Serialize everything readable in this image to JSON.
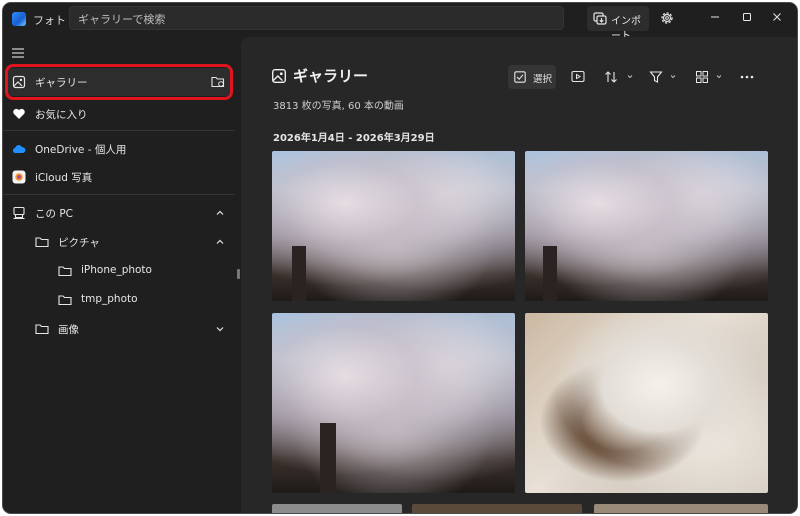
{
  "app": {
    "title": "フォト"
  },
  "search": {
    "placeholder": "ギャラリーで検索"
  },
  "titlebar": {
    "import_label": "インポート"
  },
  "sidebar": {
    "items": [
      {
        "label": "ギャラリー",
        "icon": "gallery-icon",
        "selected": true
      },
      {
        "label": "お気に入り",
        "icon": "heart-icon"
      },
      {
        "label": "OneDrive - 個人用",
        "icon": "cloud-icon"
      },
      {
        "label": "iCloud 写真",
        "icon": "icloud-icon"
      },
      {
        "label": "この PC",
        "icon": "pc-icon",
        "expanded": true
      },
      {
        "label": "ピクチャ",
        "icon": "folder-icon",
        "expanded": true
      },
      {
        "label": "iPhone_photo",
        "icon": "folder-icon"
      },
      {
        "label": "tmp_photo",
        "icon": "folder-icon"
      },
      {
        "label": "画像",
        "icon": "folder-icon",
        "expanded": false
      }
    ]
  },
  "main": {
    "title": "ギャラリー",
    "subtitle": "3813 枚の写真, 60 本の動画",
    "select_label": "選択",
    "date_range": "2026年1月4日 - 2026年3月29日",
    "photos": [
      {
        "subject": "cherry-blossom"
      },
      {
        "subject": "cherry-blossom"
      },
      {
        "subject": "cherry-blossom"
      },
      {
        "subject": "calico-cat"
      }
    ]
  },
  "colors": {
    "highlight": "#e0141e",
    "background": "#1f1f1f",
    "panel": "#272727"
  }
}
